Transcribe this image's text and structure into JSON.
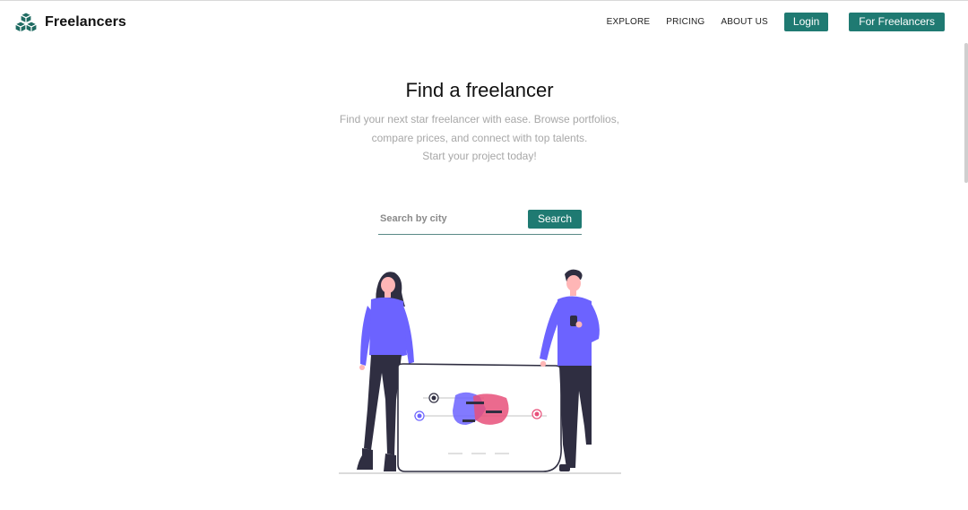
{
  "colors": {
    "accent": "#1f7a72",
    "purple": "#6c63ff",
    "pink": "#e8507a",
    "dark": "#2f2e41"
  },
  "header": {
    "brand": "Freelancers",
    "logo_icon": "cubes-icon",
    "nav": [
      "EXPLORE",
      "PRICING",
      "ABOUT US"
    ],
    "login_label": "Login",
    "freelancers_label": "For Freelancers"
  },
  "hero": {
    "title": "Find a freelancer",
    "subtitle_lines": [
      "Find your next star freelancer with ease. Browse portfolios,",
      "compare prices, and connect with top talents.",
      "Start your project today!"
    ]
  },
  "search": {
    "placeholder": "Search by city",
    "value": "",
    "button_label": "Search"
  },
  "illustration": {
    "icon": "people-with-board-illustration"
  }
}
